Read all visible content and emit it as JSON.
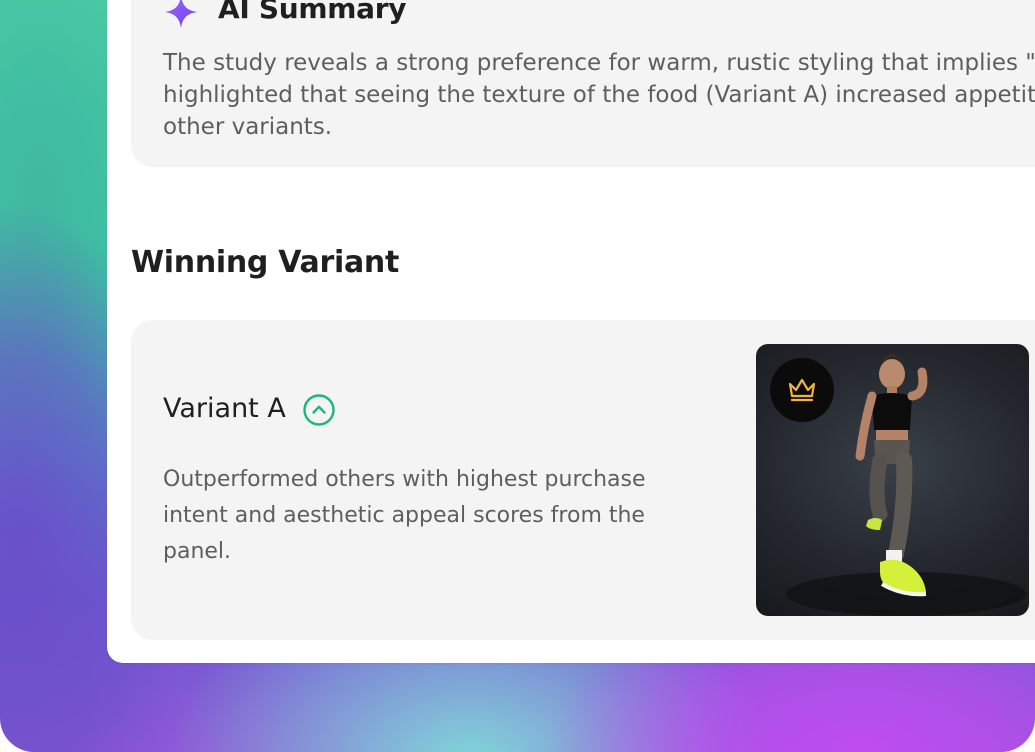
{
  "summary": {
    "title": "AI Summary",
    "icon": "sparkle-icon",
    "lines": [
      "The study reveals a strong preference for warm, rustic styling that implies \"ho",
      "highlighted that seeing the texture of the food (Variant A) increased appetite",
      "other variants."
    ]
  },
  "winning": {
    "section_title": "Winning Variant",
    "variant_name": "Variant A",
    "badge_icon": "chevron-up-circle-icon",
    "description_lines": [
      "Outperformed others with highest purchase",
      "intent and aesthetic appeal scores from the",
      "panel."
    ],
    "image_icon": "crown-icon"
  },
  "colors": {
    "accent_purple": "#8b5cf6",
    "accent_green": "#1fb57a",
    "crown_gold": "#f0b53c"
  }
}
